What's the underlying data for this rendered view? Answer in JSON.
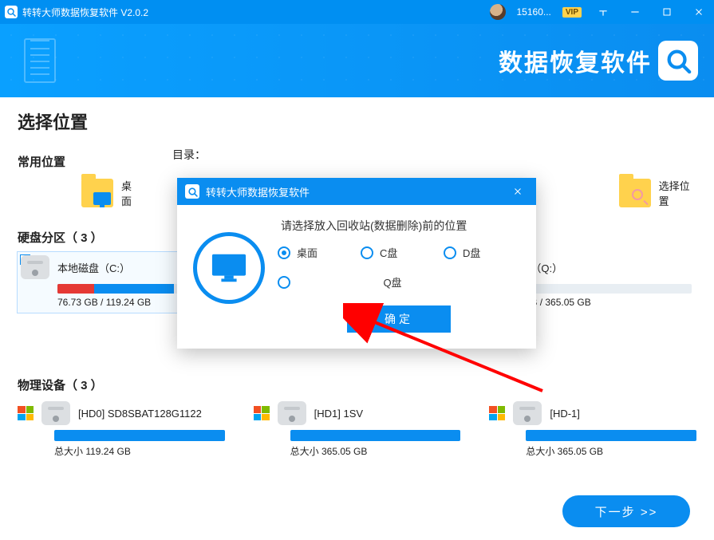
{
  "titlebar": {
    "app_title": "转转大师数据恢复软件 V2.0.2",
    "user_id": "15160...",
    "vip": "VIP"
  },
  "hero": {
    "brand_text": "数据恢复软件"
  },
  "main": {
    "title": "选择位置",
    "common_title": "常用位置",
    "dir_label": "目录：",
    "desktop_label": "桌面",
    "choose_loc_label": "选择位置",
    "partitions_title": "硬盘分区（ 3 ）",
    "partitions": [
      {
        "name": "本地磁盘（C:）",
        "size": "76.73 GB / 119.24 GB",
        "fill_pct": 64,
        "red_pct": 20,
        "selected": true
      },
      {
        "name": "磁盘（Q:）",
        "size": "46 GB / 365.05 GB",
        "fill_pct": 13,
        "red_pct": 6,
        "selected": false
      }
    ],
    "devices_title": "物理设备（ 3 ）",
    "devices": [
      {
        "name": "[HD0] SD8SBAT128G1122",
        "size": "总大小 119.24 GB"
      },
      {
        "name": "[HD1] 1SV",
        "size": "总大小 365.05 GB"
      },
      {
        "name": "[HD-1]",
        "size": "总大小 365.05 GB"
      }
    ],
    "next_label": "下一步 >>"
  },
  "modal": {
    "title": "转转大师数据恢复软件",
    "prompt": "请选择放入回收站(数据删除)前的位置",
    "options": {
      "desktop": "桌面",
      "c": "C盘",
      "d": "D盘",
      "q": "Q盘"
    },
    "ok": "确定"
  }
}
